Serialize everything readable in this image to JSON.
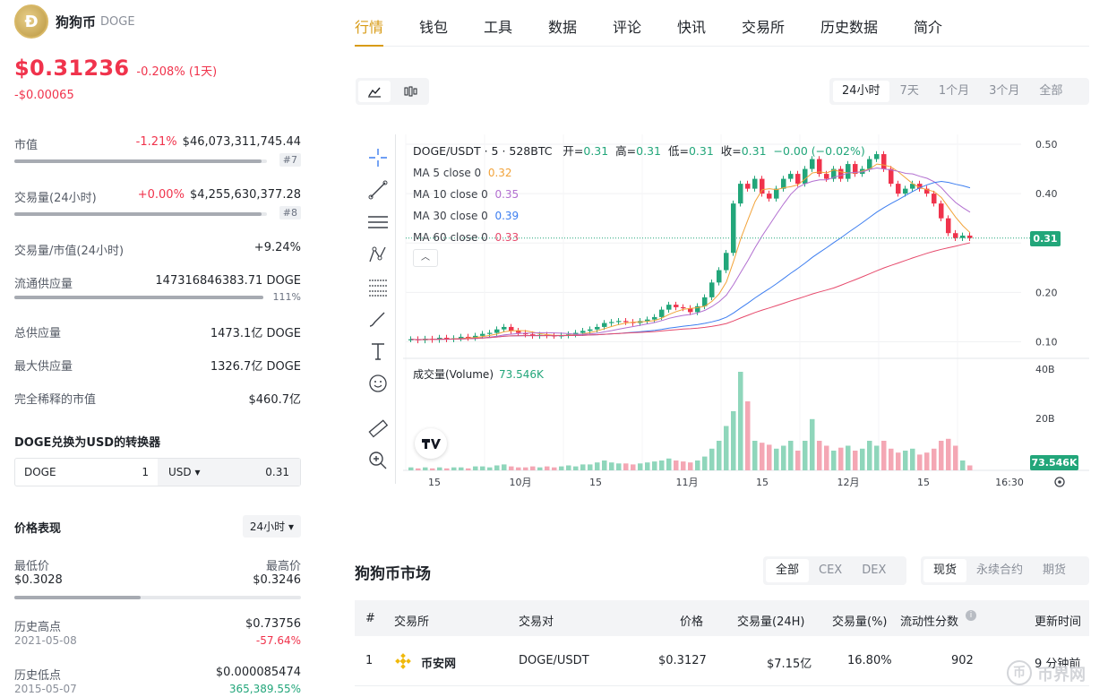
{
  "coin": {
    "name": "狗狗币",
    "symbol": "DOGE",
    "price": "$0.31236",
    "change_pct": "-0.208% (1天)",
    "change_abs": "-$0.00065"
  },
  "stats": {
    "market_cap": {
      "label": "市值",
      "pct": "-1.21%",
      "value": "$46,073,311,745.44",
      "rank": "#7",
      "fill": 0.98
    },
    "volume_24h": {
      "label": "交易量(24小时)",
      "pct": "+0.00%",
      "value": "$4,255,630,377.28",
      "rank": "#8",
      "fill": 0.98
    },
    "vol_mcap": {
      "label": "交易量/市值(24小时)",
      "value": "+9.24%"
    },
    "circulating": {
      "label": "流通供应量",
      "value": "147316846383.71 DOGE",
      "pct": "111%",
      "fill": 1.0
    },
    "total_supply": {
      "label": "总供应量",
      "value": "1473.1亿 DOGE"
    },
    "max_supply": {
      "label": "最大供应量",
      "value": "1326.7亿 DOGE"
    },
    "fdv": {
      "label": "完全稀释的市值",
      "value": "$460.7亿"
    }
  },
  "converter": {
    "title": "DOGE兑换为USD的转换器",
    "from_symbol": "DOGE",
    "from_amount": "1",
    "to_symbol": "USD ▾",
    "to_amount": "0.31"
  },
  "performance": {
    "title": "价格表现",
    "period": "24小时 ▾",
    "low_label": "最低价",
    "high_label": "最高价",
    "low": "$0.3028",
    "high": "$0.3246",
    "range_fill": 0.44,
    "ath_label": "历史高点",
    "ath_value": "$0.73756",
    "ath_date": "2021-05-08",
    "ath_pct": "-57.64%",
    "atl_label": "历史低点",
    "atl_value": "$0.000085474",
    "atl_date": "2015-05-07",
    "atl_pct": "365,389.55%"
  },
  "tabs": [
    "行情",
    "钱包",
    "工具",
    "数据",
    "评论",
    "快讯",
    "交易所",
    "历史数据",
    "简介"
  ],
  "ranges": [
    "24小时",
    "7天",
    "1个月",
    "3个月",
    "全部"
  ],
  "chart_legend": {
    "pair": "DOGE/USDT · 5 · 528BTC",
    "o_label": "开=",
    "o": "0.31",
    "h_label": "高=",
    "h": "0.31",
    "l_label": "低=",
    "l": "0.31",
    "c_label": "收=",
    "c": "0.31",
    "chg": "−0.00 (−0.02%)",
    "ma5": "MA 5 close 0",
    "ma5v": "0.32",
    "ma10": "MA 10 close 0",
    "ma10v": "0.35",
    "ma30": "MA 30 close 0",
    "ma30v": "0.39",
    "ma60": "MA 60 close 0",
    "ma60v": "0.33",
    "vol_label": "成交量(Volume)",
    "vol_value": "73.546K",
    "price_tag": "0.31",
    "vol_tag": "73.546K",
    "colors": {
      "up": "#22a67a",
      "down": "#f0334c",
      "ma5": "#f2a33a",
      "ma10": "#b26fd0",
      "ma30": "#3d7ef0",
      "ma60": "#e64a6c"
    }
  },
  "chart_data": {
    "type": "line",
    "title": "DOGE/USDT · 5 · 528BTC",
    "y_ticks": [
      "0.50",
      "0.40",
      "0.30",
      "0.20",
      "0.10"
    ],
    "vol_ticks": [
      "40B",
      "20B"
    ],
    "x_ticks": [
      "15",
      "10月",
      "15",
      "11月",
      "15",
      "12月",
      "15",
      "16:30"
    ],
    "ylim": [
      0.07,
      0.52
    ],
    "close": [
      0.105,
      0.103,
      0.106,
      0.104,
      0.108,
      0.105,
      0.107,
      0.11,
      0.108,
      0.112,
      0.116,
      0.118,
      0.125,
      0.13,
      0.122,
      0.118,
      0.115,
      0.112,
      0.114,
      0.113,
      0.112,
      0.113,
      0.115,
      0.118,
      0.122,
      0.125,
      0.13,
      0.138,
      0.14,
      0.142,
      0.14,
      0.138,
      0.142,
      0.145,
      0.15,
      0.165,
      0.175,
      0.17,
      0.168,
      0.16,
      0.172,
      0.19,
      0.22,
      0.245,
      0.28,
      0.38,
      0.42,
      0.41,
      0.43,
      0.4,
      0.39,
      0.41,
      0.43,
      0.44,
      0.42,
      0.45,
      0.47,
      0.44,
      0.43,
      0.45,
      0.43,
      0.46,
      0.44,
      0.45,
      0.47,
      0.48,
      0.45,
      0.42,
      0.4,
      0.41,
      0.42,
      0.41,
      0.4,
      0.38,
      0.35,
      0.32,
      0.31,
      0.315,
      0.31
    ],
    "ma5": [
      0.32
    ],
    "volume_pct": [
      0.03,
      0.02,
      0.03,
      0.02,
      0.03,
      0.02,
      0.03,
      0.03,
      0.02,
      0.04,
      0.04,
      0.03,
      0.05,
      0.06,
      0.04,
      0.03,
      0.03,
      0.04,
      0.03,
      0.04,
      0.03,
      0.04,
      0.05,
      0.04,
      0.06,
      0.06,
      0.08,
      0.1,
      0.08,
      0.07,
      0.07,
      0.06,
      0.07,
      0.08,
      0.09,
      0.1,
      0.12,
      0.1,
      0.09,
      0.08,
      0.1,
      0.14,
      0.22,
      0.3,
      0.45,
      0.6,
      1.0,
      0.7,
      0.3,
      0.28,
      0.26,
      0.22,
      0.25,
      0.3,
      0.2,
      0.3,
      0.52,
      0.3,
      0.25,
      0.2,
      0.23,
      0.25,
      0.2,
      0.22,
      0.3,
      0.25,
      0.3,
      0.22,
      0.18,
      0.2,
      0.22,
      0.16,
      0.18,
      0.22,
      0.3,
      0.32,
      0.25,
      0.1,
      0.05
    ],
    "grid": true
  },
  "market": {
    "title": "狗狗币市场",
    "seg1": [
      "全部",
      "CEX",
      "DEX"
    ],
    "seg2": [
      "现货",
      "永续合约",
      "期货"
    ],
    "headers": [
      "#",
      "交易所",
      "交易对",
      "价格",
      "交易量(24H)",
      "交易量(%)",
      "流动性分数",
      "更新时间"
    ],
    "rows": [
      {
        "idx": "1",
        "exchange": "币安网",
        "pair": "DOGE/USDT",
        "price": "$0.3127",
        "vol": "$7.15亿",
        "vol_pct": "16.80%",
        "liq": "902",
        "updated": "9 分钟前"
      }
    ]
  },
  "watermark": {
    "text": "币界网"
  }
}
